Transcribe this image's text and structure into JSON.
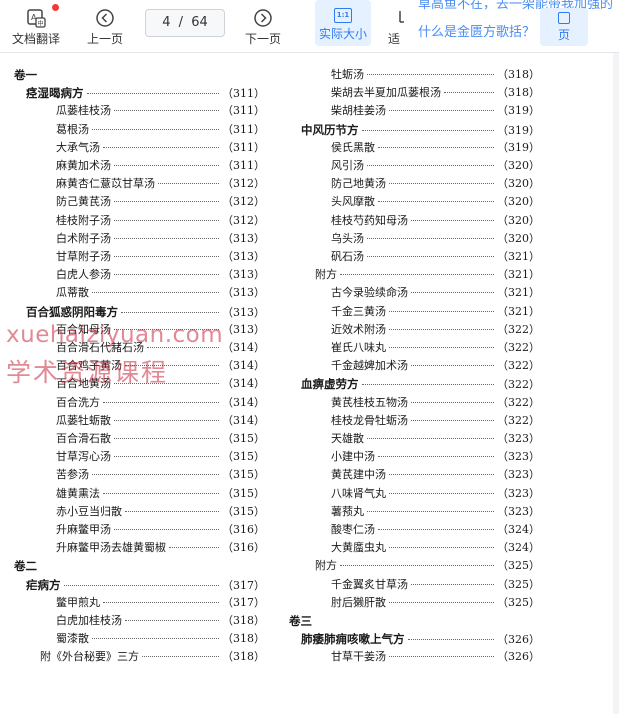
{
  "toolbar": {
    "translate_label": "文档翻译",
    "prev_label": "上一页",
    "page_current": "4",
    "page_separator": "/",
    "page_total": "64",
    "next_label": "下一页",
    "actual_size_label": "实际大小",
    "actual_size_icon_text": "1:1",
    "fit_label": "适",
    "banner_question_top": "草高鱼不在，去一架能带我加强的",
    "banner_question": "什么是金匮方歌括？",
    "blue_button_label": "页",
    "colors": {
      "accent": "#2f7bf2",
      "badge": "#f03a3a"
    }
  },
  "watermark": {
    "line1": "xuehaiziyuan.com",
    "line2": "学术资源课程"
  },
  "toc_left": [
    {
      "text": "卷一",
      "page": "",
      "kind": "vol",
      "indent": 0
    },
    {
      "text": "痉湿暍病方",
      "page": "（311）",
      "kind": "sec",
      "indent": 1
    },
    {
      "text": "瓜蒌桂枝汤",
      "page": "（311）",
      "kind": "item",
      "indent": 2
    },
    {
      "text": "葛根汤",
      "page": "（311）",
      "kind": "item",
      "indent": 2
    },
    {
      "text": "大承气汤",
      "page": "（311）",
      "kind": "item",
      "indent": 2
    },
    {
      "text": "麻黄加术汤",
      "page": "（311）",
      "kind": "item",
      "indent": 2
    },
    {
      "text": "麻黄杏仁薏苡甘草汤",
      "page": "（312）",
      "kind": "item",
      "indent": 2
    },
    {
      "text": "防己黄芪汤",
      "page": "（312）",
      "kind": "item",
      "indent": 2
    },
    {
      "text": "桂枝附子汤",
      "page": "（312）",
      "kind": "item",
      "indent": 2
    },
    {
      "text": "白术附子汤",
      "page": "（313）",
      "kind": "item",
      "indent": 2
    },
    {
      "text": "甘草附子汤",
      "page": "（313）",
      "kind": "item",
      "indent": 2
    },
    {
      "text": "白虎人参汤",
      "page": "（313）",
      "kind": "item",
      "indent": 2
    },
    {
      "text": "瓜蒂散",
      "page": "（313）",
      "kind": "item",
      "indent": 2
    },
    {
      "text": "百合狐惑阴阳毒方",
      "page": "（313）",
      "kind": "sec",
      "indent": 1
    },
    {
      "text": "百合知母汤",
      "page": "（313）",
      "kind": "item",
      "indent": 2
    },
    {
      "text": "百合滑石代赭石汤",
      "page": "（314）",
      "kind": "item",
      "indent": 2
    },
    {
      "text": "百合鸡子黄汤",
      "page": "（314）",
      "kind": "item",
      "indent": 2
    },
    {
      "text": "百合地黄汤",
      "page": "（314）",
      "kind": "item",
      "indent": 2
    },
    {
      "text": "百合洗方",
      "page": "（314）",
      "kind": "item",
      "indent": 2
    },
    {
      "text": "瓜蒌牡蛎散",
      "page": "（314）",
      "kind": "item",
      "indent": 2
    },
    {
      "text": "百合滑石散",
      "page": "（315）",
      "kind": "item",
      "indent": 2
    },
    {
      "text": "甘草泻心汤",
      "page": "（315）",
      "kind": "item",
      "indent": 2
    },
    {
      "text": "苦参汤",
      "page": "（315）",
      "kind": "item",
      "indent": 2
    },
    {
      "text": "雄黄熏法",
      "page": "（315）",
      "kind": "item",
      "indent": 2
    },
    {
      "text": "赤小豆当归散",
      "page": "（315）",
      "kind": "item",
      "indent": 2
    },
    {
      "text": "升麻鳖甲汤",
      "page": "（316）",
      "kind": "item",
      "indent": 2
    },
    {
      "text": "升麻鳖甲汤去雄黄蜀椒",
      "page": "（316）",
      "kind": "item",
      "indent": 2
    },
    {
      "text": "卷二",
      "page": "",
      "kind": "vol",
      "indent": 0
    },
    {
      "text": "疟病方",
      "page": "（317）",
      "kind": "sec",
      "indent": 1
    },
    {
      "text": "鳖甲煎丸",
      "page": "（317）",
      "kind": "item",
      "indent": 2
    },
    {
      "text": "白虎加桂枝汤",
      "page": "（318）",
      "kind": "item",
      "indent": 2
    },
    {
      "text": "蜀漆散",
      "page": "（318）",
      "kind": "item",
      "indent": 2
    },
    {
      "text": "附《外台秘要》三方",
      "page": "（318）",
      "kind": "item",
      "indent": 1.5
    }
  ],
  "toc_right": [
    {
      "text": "牡蛎汤",
      "page": "（318）",
      "kind": "item",
      "indent": 2
    },
    {
      "text": "柴胡去半夏加瓜蒌根汤",
      "page": "（318）",
      "kind": "item",
      "indent": 2
    },
    {
      "text": "柴胡桂姜汤",
      "page": "（319）",
      "kind": "item",
      "indent": 2
    },
    {
      "text": "中风历节方",
      "page": "（319）",
      "kind": "sec",
      "indent": 1
    },
    {
      "text": "侯氏黑散",
      "page": "（319）",
      "kind": "item",
      "indent": 2
    },
    {
      "text": "风引汤",
      "page": "（320）",
      "kind": "item",
      "indent": 2
    },
    {
      "text": "防己地黄汤",
      "page": "（320）",
      "kind": "item",
      "indent": 2
    },
    {
      "text": "头风摩散",
      "page": "（320）",
      "kind": "item",
      "indent": 2
    },
    {
      "text": "桂枝芍药知母汤",
      "page": "（320）",
      "kind": "item",
      "indent": 2
    },
    {
      "text": "乌头汤",
      "page": "（320）",
      "kind": "item",
      "indent": 2
    },
    {
      "text": "矾石汤",
      "page": "（321）",
      "kind": "item",
      "indent": 2
    },
    {
      "text": "附方",
      "page": "（321）",
      "kind": "item",
      "indent": 1.5
    },
    {
      "text": "古今录验续命汤",
      "page": "（321）",
      "kind": "item",
      "indent": 2
    },
    {
      "text": "千金三黄汤",
      "page": "（321）",
      "kind": "item",
      "indent": 2
    },
    {
      "text": "近效术附汤",
      "page": "（322）",
      "kind": "item",
      "indent": 2
    },
    {
      "text": "崔氏八味丸",
      "page": "（322）",
      "kind": "item",
      "indent": 2
    },
    {
      "text": "千金越婢加术汤",
      "page": "（322）",
      "kind": "item",
      "indent": 2
    },
    {
      "text": "血痹虚劳方",
      "page": "（322）",
      "kind": "sec",
      "indent": 1
    },
    {
      "text": "黄芪桂枝五物汤",
      "page": "（322）",
      "kind": "item",
      "indent": 2
    },
    {
      "text": "桂枝龙骨牡蛎汤",
      "page": "（322）",
      "kind": "item",
      "indent": 2
    },
    {
      "text": "天雄散",
      "page": "（323）",
      "kind": "item",
      "indent": 2
    },
    {
      "text": "小建中汤",
      "page": "（323）",
      "kind": "item",
      "indent": 2
    },
    {
      "text": "黄芪建中汤",
      "page": "（323）",
      "kind": "item",
      "indent": 2
    },
    {
      "text": "八味肾气丸",
      "page": "（323）",
      "kind": "item",
      "indent": 2
    },
    {
      "text": "薯蓣丸",
      "page": "（323）",
      "kind": "item",
      "indent": 2
    },
    {
      "text": "酸枣仁汤",
      "page": "（324）",
      "kind": "item",
      "indent": 2
    },
    {
      "text": "大黄䗪虫丸",
      "page": "（324）",
      "kind": "item",
      "indent": 2
    },
    {
      "text": "附方",
      "page": "（325）",
      "kind": "item",
      "indent": 1.5
    },
    {
      "text": "千金翼炙甘草汤",
      "page": "（325）",
      "kind": "item",
      "indent": 2
    },
    {
      "text": "肘后獭肝散",
      "page": "（325）",
      "kind": "item",
      "indent": 2
    },
    {
      "text": "卷三",
      "page": "",
      "kind": "vol",
      "indent": 0
    },
    {
      "text": "肺痿肺痈咳嗽上气方",
      "page": "（326）",
      "kind": "sec",
      "indent": 1
    },
    {
      "text": "甘草干姜汤",
      "page": "（326）",
      "kind": "item",
      "indent": 2
    }
  ]
}
